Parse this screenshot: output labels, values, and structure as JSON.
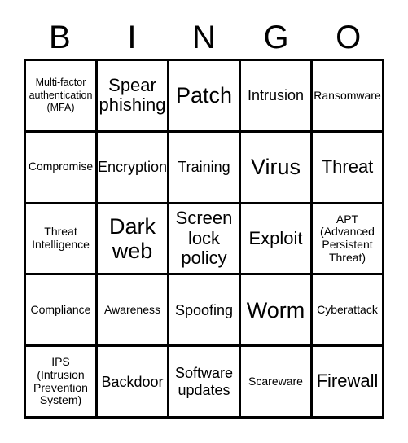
{
  "card": {
    "header_letters": [
      "B",
      "I",
      "N",
      "G",
      "O"
    ],
    "rows": [
      [
        {
          "text": "Multi-factor authentication (MFA)",
          "size": "xs"
        },
        {
          "text": "Spear phishing",
          "size": "lg"
        },
        {
          "text": "Patch",
          "size": "xl"
        },
        {
          "text": "Intrusion",
          "size": "md"
        },
        {
          "text": "Ransomware",
          "size": "sm"
        }
      ],
      [
        {
          "text": "Compromise",
          "size": "sm"
        },
        {
          "text": "Encryption",
          "size": "md"
        },
        {
          "text": "Training",
          "size": "md"
        },
        {
          "text": "Virus",
          "size": "xl"
        },
        {
          "text": "Threat",
          "size": "lg"
        }
      ],
      [
        {
          "text": "Threat Intelligence",
          "size": "sm"
        },
        {
          "text": "Dark web",
          "size": "xl"
        },
        {
          "text": "Screen lock policy",
          "size": "lg"
        },
        {
          "text": "Exploit",
          "size": "lg"
        },
        {
          "text": "APT (Advanced Persistent Threat)",
          "size": "sm"
        }
      ],
      [
        {
          "text": "Compliance",
          "size": "sm"
        },
        {
          "text": "Awareness",
          "size": "sm"
        },
        {
          "text": "Spoofing",
          "size": "md"
        },
        {
          "text": "Worm",
          "size": "xl"
        },
        {
          "text": "Cyberattack",
          "size": "sm"
        }
      ],
      [
        {
          "text": "IPS (Intrusion Prevention System)",
          "size": "sm"
        },
        {
          "text": "Backdoor",
          "size": "md"
        },
        {
          "text": "Software updates",
          "size": "md"
        },
        {
          "text": "Scareware",
          "size": "sm"
        },
        {
          "text": "Firewall",
          "size": "lg"
        }
      ]
    ]
  }
}
